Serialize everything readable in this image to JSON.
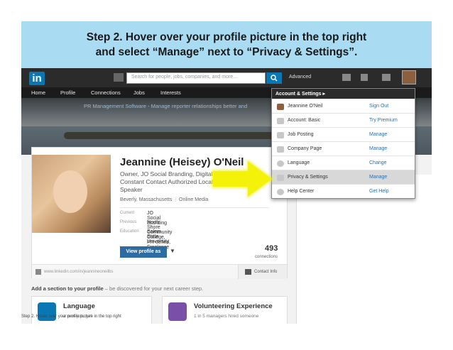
{
  "slide": {
    "title_line1": "Step 2.  Hover over your profile picture in the top right",
    "title_line2": "and select “Manage” next to “Privacy & Settings”."
  },
  "colors": {
    "banner": "#a9dcf3",
    "linkedin_blue": "#0a77b5",
    "arrow_yellow": "#f5f20a"
  },
  "topbar": {
    "logo": "in",
    "search_placeholder": "Search for people, jobs, companies, and more...",
    "advanced": "Advanced"
  },
  "nav": [
    "Home",
    "Profile",
    "Connections",
    "Jobs",
    "Interests"
  ],
  "hero": {
    "text": "PR Management Software - Manage reporter relationships better and"
  },
  "profile": {
    "name": "Jeannine (Heisey) O'Neil",
    "headline_line1": "Owner, JO Social Branding, Digital Ma",
    "headline_line2": "Constant Contact Authorized Local Ex",
    "headline_line3": "Speaker",
    "location": "Beverly, Massachusetts",
    "industry": "Online Media",
    "facts": [
      {
        "label": "Current",
        "value": "JO Social Branding"
      },
      {
        "label": "Previous",
        "value": "North Shore Community College, PR-defied, Freelance"
      },
      {
        "label": "Education",
        "value": "Salem State University"
      }
    ],
    "view_button": "View profile as",
    "connections_count": "493",
    "connections_label": "connections",
    "url": "www.linkedin.com/in/jeannineoneilbs",
    "contact_info": "Contact Info"
  },
  "add_section": {
    "bold": "Add a section to your profile",
    "rest": " – be discovered for your next career step."
  },
  "section_cards": [
    {
      "title": "Language",
      "desc": "                        a new job, get"
    },
    {
      "title": "Volunteering Experience",
      "desc": "1 in 5 managers hired someone"
    }
  ],
  "watermark": "Step 2.  Hover over your profile picture in the top right",
  "dropdown": {
    "header": "Account & Settings ▸",
    "rows": [
      {
        "icon": "user-icon",
        "label": "Jeannine O'Neil",
        "action": "Sign Out"
      },
      {
        "icon": "account-icon",
        "label": "Account: Basic",
        "action": "Try Premium"
      },
      {
        "icon": "briefcase-icon",
        "label": "Job Posting",
        "action": "Manage"
      },
      {
        "icon": "company-icon",
        "label": "Company Page",
        "action": "Manage"
      },
      {
        "icon": "globe-icon",
        "label": "Language",
        "action": "Change"
      },
      {
        "icon": "lock-icon",
        "label": "Privacy & Settings",
        "action": "Manage"
      },
      {
        "icon": "help-icon",
        "label": "Help Center",
        "action": "Get Help"
      }
    ]
  }
}
